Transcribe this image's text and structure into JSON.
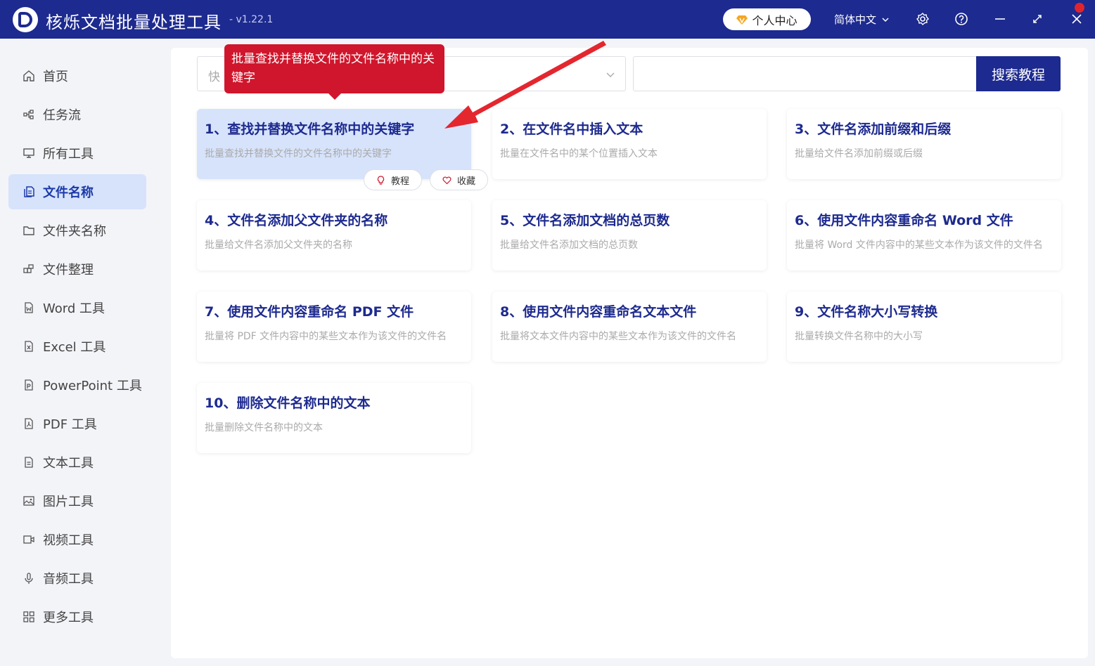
{
  "titlebar": {
    "app_title": "核烁文档批量处理工具",
    "version": "- v1.22.1",
    "user_center_label": "个人中心",
    "language": "简体中文",
    "accent_color": "#1d2a8f"
  },
  "sidebar": {
    "items": [
      {
        "label": "首页",
        "icon": "home-icon"
      },
      {
        "label": "任务流",
        "icon": "workflow-icon"
      },
      {
        "label": "所有工具",
        "icon": "monitor-icon"
      },
      {
        "label": "文件名称",
        "icon": "file-copy-icon",
        "active": true
      },
      {
        "label": "文件夹名称",
        "icon": "folder-icon"
      },
      {
        "label": "文件整理",
        "icon": "organize-icon"
      },
      {
        "label": "Word 工具",
        "icon": "word-icon"
      },
      {
        "label": "Excel 工具",
        "icon": "excel-icon"
      },
      {
        "label": "PowerPoint 工具",
        "icon": "ppt-icon"
      },
      {
        "label": "PDF 工具",
        "icon": "pdf-icon"
      },
      {
        "label": "文本工具",
        "icon": "text-file-icon"
      },
      {
        "label": "图片工具",
        "icon": "image-icon"
      },
      {
        "label": "视频工具",
        "icon": "video-icon"
      },
      {
        "label": "音频工具",
        "icon": "microphone-icon"
      },
      {
        "label": "更多工具",
        "icon": "grid-icon"
      }
    ]
  },
  "search": {
    "select_placeholder": "快",
    "button_label": "搜索教程"
  },
  "tooltip": {
    "text": "批量查找并替换文件的文件名称中的关键字"
  },
  "cards": [
    {
      "title": "1、查找并替换文件名称中的关键字",
      "desc": "批量查找并替换文件的文件名称中的关键字"
    },
    {
      "title": "2、在文件名中插入文本",
      "desc": "批量在文件名中的某个位置插入文本"
    },
    {
      "title": "3、文件名添加前缀和后缀",
      "desc": "批量给文件名添加前缀或后缀"
    },
    {
      "title": "4、文件名添加父文件夹的名称",
      "desc": "批量给文件名添加父文件夹的名称"
    },
    {
      "title": "5、文件名添加文档的总页数",
      "desc": "批量给文件名添加文档的总页数"
    },
    {
      "title": "6、使用文件内容重命名 Word 文件",
      "desc": "批量将 Word 文件内容中的某些文本作为该文件的文件名"
    },
    {
      "title": "7、使用文件内容重命名 PDF 文件",
      "desc": "批量将 PDF 文件内容中的某些文本作为该文件的文件名"
    },
    {
      "title": "8、使用文件内容重命名文本文件",
      "desc": "批量将文本文件内容中的某些文本作为该文件的文件名"
    },
    {
      "title": "9、文件名称大小写转换",
      "desc": "批量转换文件名称中的大小写"
    },
    {
      "title": "10、删除文件名称中的文本",
      "desc": "批量删除文件名称中的文本"
    }
  ],
  "card_actions": {
    "tutorial_label": "教程",
    "favorite_label": "收藏"
  }
}
